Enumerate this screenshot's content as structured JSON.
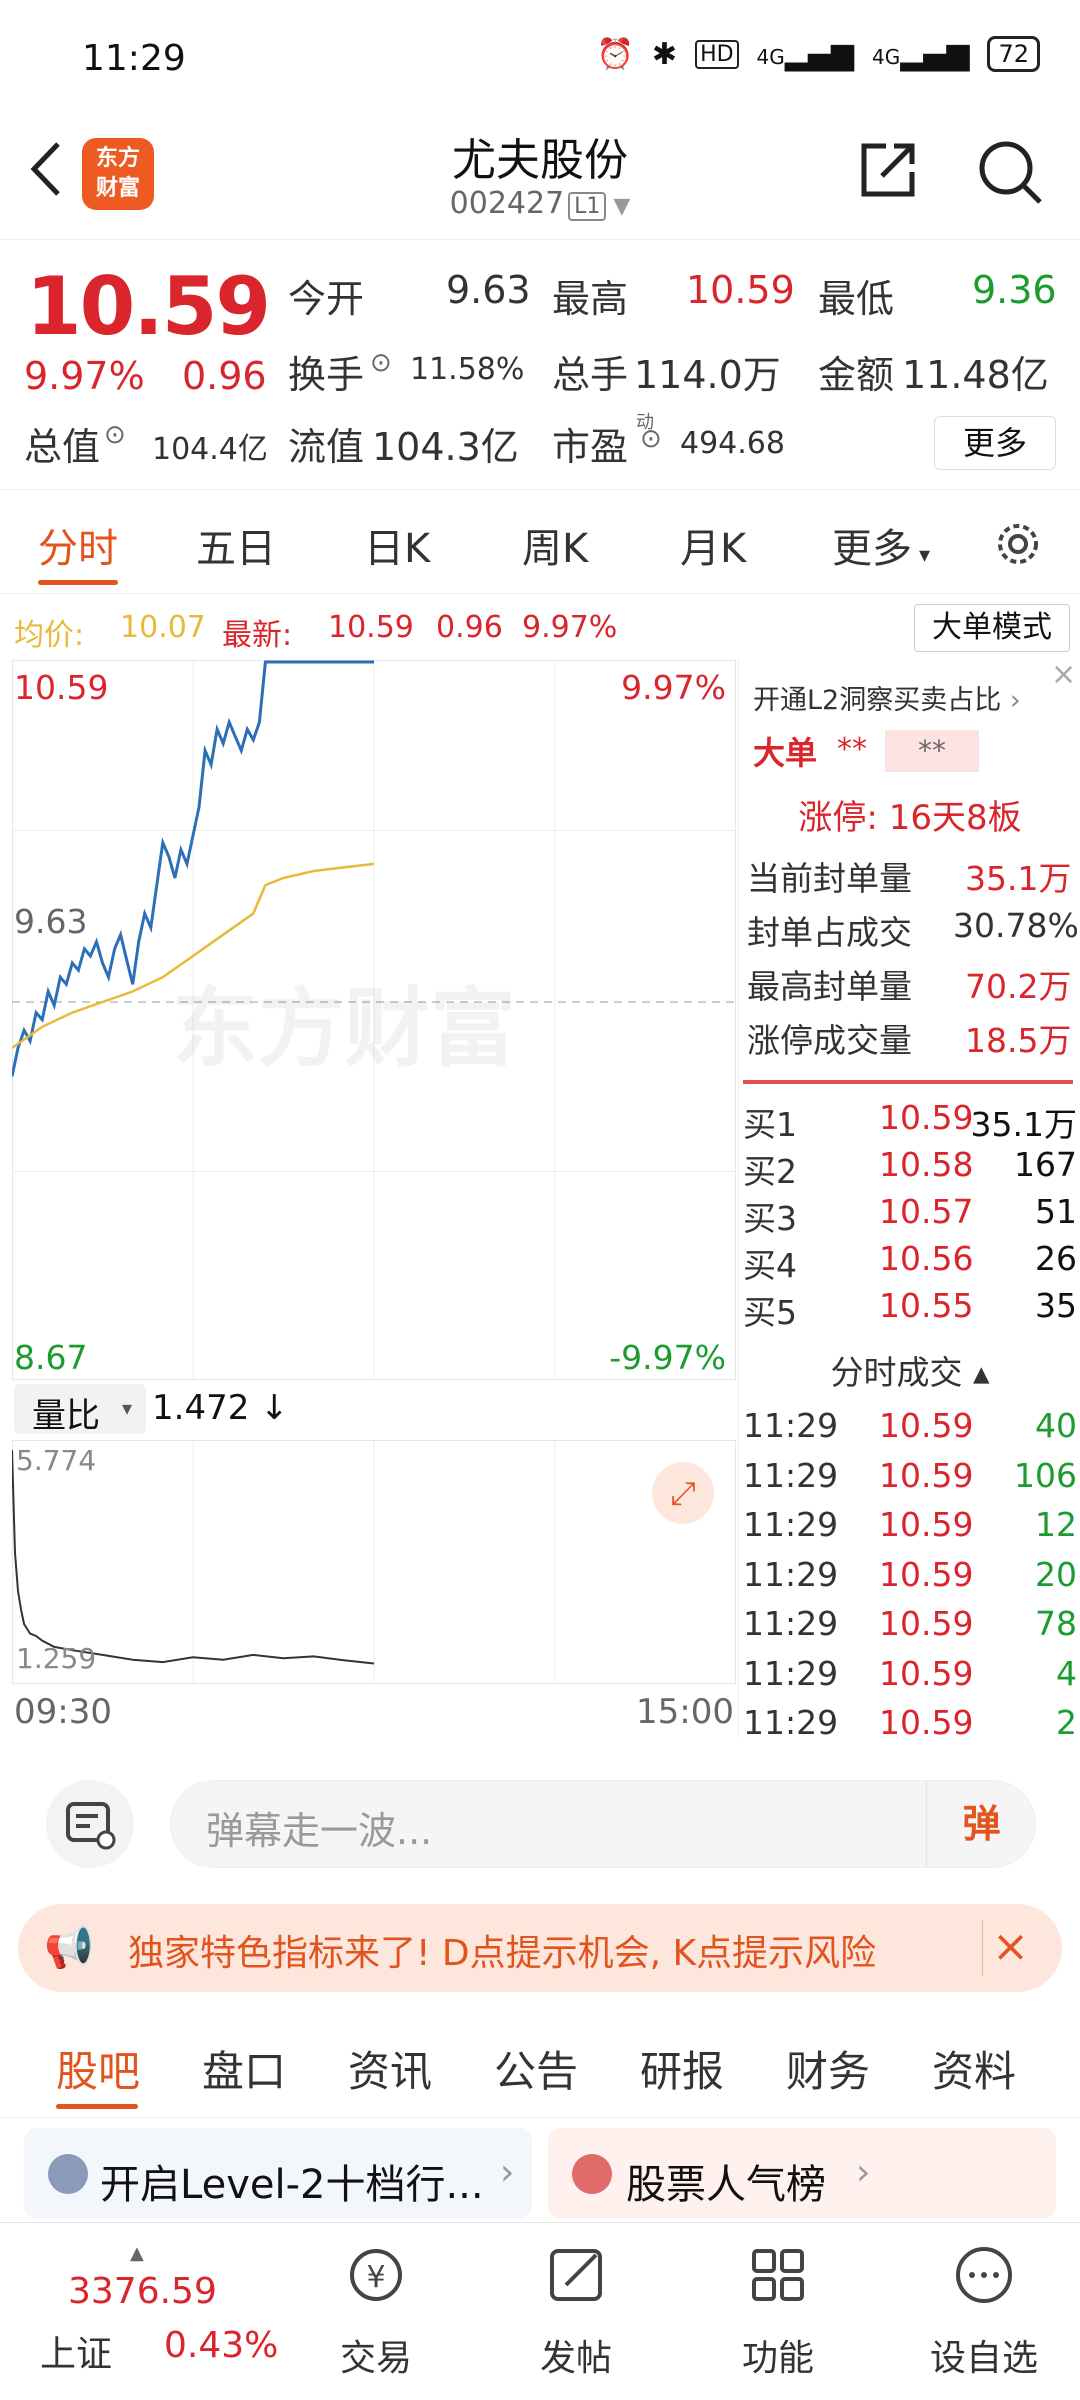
{
  "status_bar": {
    "time": "11:29",
    "battery": "72",
    "net1": "4G",
    "net2": "4G",
    "hd": "HD"
  },
  "header": {
    "back_label": "‹",
    "logo_line1": "东方",
    "logo_line2": "财富",
    "stock_name": "尤夫股份",
    "stock_code": "002427",
    "level_badge": "L1"
  },
  "quote": {
    "price": "10.59",
    "change_pct": "9.97%",
    "change": "0.96",
    "open_label": "今开",
    "open": "9.63",
    "high_label": "最高",
    "high": "10.59",
    "low_label": "最低",
    "low": "9.36",
    "turnover_label": "换手",
    "turnover": "11.58%",
    "volume_label": "总手",
    "volume": "114.0万",
    "amount_label": "金额",
    "amount": "11.48亿",
    "total_cap_label": "总值",
    "total_cap": "104.4亿",
    "float_cap_label": "流值",
    "float_cap": "104.3亿",
    "pe_label": "市盈",
    "pe_sup": "动",
    "pe": "494.68",
    "more_button": "更多"
  },
  "tabs": [
    "分时",
    "五日",
    "日K",
    "周K",
    "月K",
    "更多"
  ],
  "avg_info": {
    "avg_label": "均价:",
    "avg": "10.07",
    "latest_label": "最新:",
    "latest": "10.59",
    "change": "0.96",
    "pct": "9.97%",
    "big_order_button": "大单模式"
  },
  "chart_data": {
    "type": "line",
    "price_axis": {
      "top": "10.59",
      "mid": "9.63",
      "bottom": "8.67",
      "ylim": [
        8.67,
        10.59
      ]
    },
    "pct_axis": {
      "top": "9.97%",
      "bottom": "-9.97%"
    },
    "x_labels": [
      "09:30",
      "15:00"
    ],
    "watermark": "东方财富",
    "series": [
      {
        "name": "price",
        "color": "#2d6fb7",
        "x": [
          0,
          2,
          4,
          6,
          8,
          10,
          12,
          14,
          16,
          18,
          20,
          22,
          24,
          26,
          28,
          30,
          32,
          34,
          36,
          38,
          40,
          42,
          44,
          46,
          48,
          50,
          52,
          54,
          56,
          58,
          60,
          62,
          64,
          66,
          68,
          70,
          72,
          74,
          76,
          78,
          80,
          82,
          84,
          86,
          88,
          90,
          92,
          94,
          96,
          98,
          100,
          102,
          104,
          106,
          108,
          110,
          112,
          114,
          116,
          118,
          120
        ],
        "values": [
          9.42,
          9.5,
          9.55,
          9.52,
          9.6,
          9.58,
          9.66,
          9.62,
          9.7,
          9.68,
          9.74,
          9.72,
          9.78,
          9.76,
          9.8,
          9.74,
          9.7,
          9.78,
          9.82,
          9.75,
          9.68,
          9.8,
          9.88,
          9.84,
          9.96,
          10.08,
          10.04,
          9.98,
          10.06,
          10.02,
          10.1,
          10.18,
          10.34,
          10.3,
          10.4,
          10.36,
          10.42,
          10.38,
          10.34,
          10.4,
          10.37,
          10.42,
          10.59,
          10.59,
          10.59,
          10.59,
          10.59,
          10.59,
          10.59,
          10.59,
          10.59,
          10.59,
          10.59,
          10.59,
          10.59,
          10.59,
          10.59,
          10.59,
          10.59,
          10.59,
          10.59
        ]
      },
      {
        "name": "avg",
        "color": "#e9b93a",
        "x": [
          0,
          10,
          20,
          30,
          40,
          50,
          60,
          70,
          80,
          84,
          90,
          100,
          110,
          120
        ],
        "values": [
          9.5,
          9.56,
          9.6,
          9.63,
          9.66,
          9.7,
          9.76,
          9.82,
          9.88,
          9.96,
          9.98,
          10.0,
          10.01,
          10.02
        ]
      }
    ],
    "x_total": 240,
    "volume_ratio": {
      "label": "量比",
      "value": "1.472",
      "top": "5.774",
      "bottom": "1.259",
      "ylim": [
        1.259,
        5.774
      ],
      "x": [
        0,
        1,
        2,
        3,
        4,
        6,
        8,
        10,
        14,
        20,
        30,
        40,
        50,
        60,
        70,
        80,
        90,
        100,
        110,
        120
      ],
      "values": [
        5.774,
        3.6,
        2.8,
        2.4,
        2.1,
        1.9,
        1.85,
        1.75,
        1.62,
        1.55,
        1.45,
        1.35,
        1.3,
        1.4,
        1.35,
        1.45,
        1.38,
        1.42,
        1.34,
        1.27
      ]
    }
  },
  "right_panel": {
    "l2_promo": "开通L2洞察买卖占比",
    "big_label": "大单",
    "big_masked1": "**",
    "big_masked2": "**",
    "limit_up_label": "涨停:",
    "limit_up_value": "16天8板",
    "seal_qty_label": "当前封单量",
    "seal_qty": "35.1万",
    "seal_ratio_label": "封单占成交",
    "seal_ratio": "30.78%",
    "max_seal_label": "最高封单量",
    "max_seal": "70.2万",
    "limit_vol_label": "涨停成交量",
    "limit_vol": "18.5万",
    "bids": [
      {
        "label": "买1",
        "price": "10.59",
        "qty": "35.1万"
      },
      {
        "label": "买2",
        "price": "10.58",
        "qty": "167"
      },
      {
        "label": "买3",
        "price": "10.57",
        "qty": "51"
      },
      {
        "label": "买4",
        "price": "10.56",
        "qty": "26"
      },
      {
        "label": "买5",
        "price": "10.55",
        "qty": "35"
      }
    ],
    "ticks_title": "分时成交",
    "ticks": [
      {
        "time": "11:29",
        "price": "10.59",
        "qty": "40"
      },
      {
        "time": "11:29",
        "price": "10.59",
        "qty": "106"
      },
      {
        "time": "11:29",
        "price": "10.59",
        "qty": "12"
      },
      {
        "time": "11:29",
        "price": "10.59",
        "qty": "20"
      },
      {
        "time": "11:29",
        "price": "10.59",
        "qty": "78"
      },
      {
        "time": "11:29",
        "price": "10.59",
        "qty": "4"
      },
      {
        "time": "11:29",
        "price": "10.59",
        "qty": "2"
      }
    ]
  },
  "danmu": {
    "placeholder": "弹幕走一波...",
    "button": "弹"
  },
  "banner": {
    "text": "独家特色指标来了! D点提示机会, K点提示风险"
  },
  "lower_tabs": [
    "股吧",
    "盘口",
    "资讯",
    "公告",
    "研报",
    "财务",
    "资料"
  ],
  "cards": [
    {
      "text": "开启Level-2十档行..."
    },
    {
      "text": "股票人气榜"
    }
  ],
  "bottom_nav": {
    "index_value": "3376.59",
    "index_name": "上证",
    "index_pct": "0.43%",
    "items": [
      "交易",
      "发帖",
      "功能",
      "设自选"
    ]
  },
  "colors": {
    "up": "#d9252b",
    "down": "#1c9b2f",
    "accent": "#e2531d",
    "price_line": "#2d6fb7",
    "avg_line": "#e9b93a"
  }
}
